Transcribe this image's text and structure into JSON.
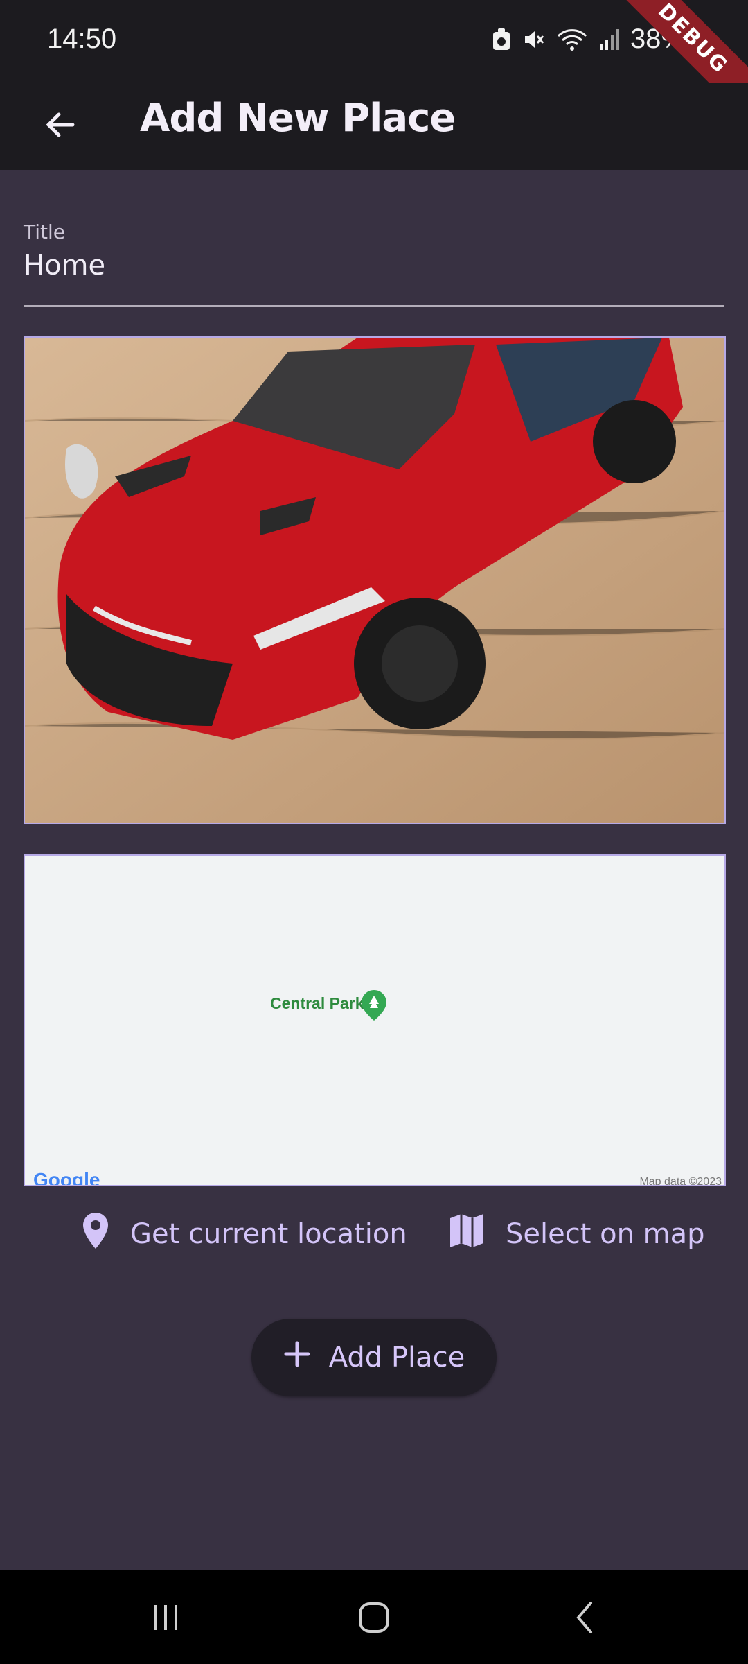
{
  "status_bar": {
    "time": "14:50",
    "battery_percent": "38%",
    "debug_banner": "DEBUG",
    "icons": [
      "clean-icon",
      "mute-icon",
      "wifi-icon",
      "signal-icon"
    ]
  },
  "app_bar": {
    "title": "Add New Place",
    "back_icon": "arrow-back-icon"
  },
  "form": {
    "title_label": "Title",
    "title_value": "Home"
  },
  "map": {
    "place_label": "Central Park",
    "logo_text": "Google",
    "attribution": "Map data ©2023"
  },
  "actions": {
    "current_location_label": "Get current location",
    "select_on_map_label": "Select on map",
    "add_place_label": "Add Place"
  },
  "colors": {
    "background": "#383142",
    "appbar": "#1c1b1f",
    "accent": "#d3c4f8",
    "border": "#b6a9e6"
  }
}
